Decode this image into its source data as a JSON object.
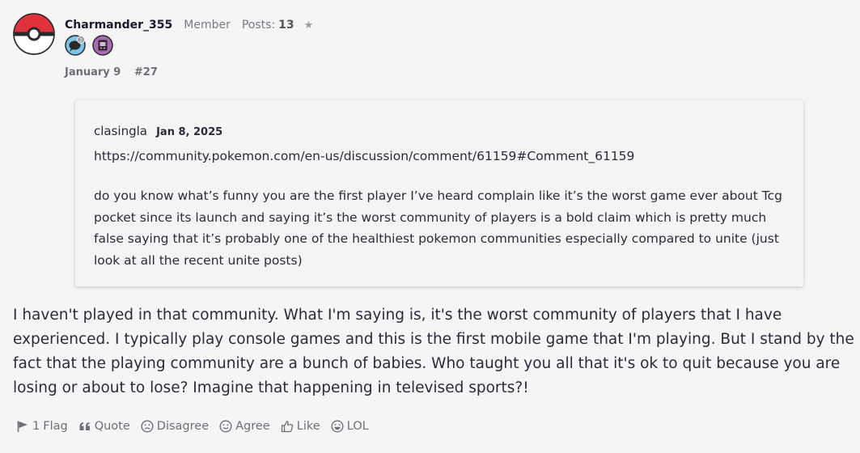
{
  "author": {
    "username": "Charmander_355",
    "role": "Member",
    "posts_label": "Posts:",
    "posts_count": "13",
    "star": "★",
    "avatar_icon": "pokeball-icon",
    "badges": [
      "comment-badge-icon",
      "pokedex-badge-icon"
    ],
    "badge_count": "2"
  },
  "meta": {
    "date": "January 9",
    "post_number": "#27"
  },
  "quote": {
    "author": "clasingla",
    "date": "Jan 8, 2025",
    "link": "https://community.pokemon.com/en-us/discussion/comment/61159#Comment_61159",
    "body": "do you know what’s funny you are the first player I’ve heard complain like it’s the worst game ever about Tcg pocket since its launch and saying it’s the worst community of players is a bold claim which is pretty much false saying that it’s probably one of the healthiest pokemon communities especially compared to unite (just look at all the recent unite posts)"
  },
  "post": {
    "body": "I haven't played in that community. What I'm saying is, it's the worst community of players that I have experienced. I typically play console games and this is the first mobile game that I'm playing. But I stand by the fact that the playing community are a bunch of babies. Who taught you all that it's ok to quit because you are losing or about to lose? Imagine that happening in televised sports?!"
  },
  "reactions": {
    "flag_count": "1",
    "flag": "Flag",
    "quote": "Quote",
    "disagree": "Disagree",
    "agree": "Agree",
    "like": "Like",
    "lol": "LOL"
  },
  "colors": {
    "background": "#f5f5f5",
    "text": "#2b2b3a",
    "muted": "#6e6e7a",
    "pokeball_red": "#e0323a"
  }
}
